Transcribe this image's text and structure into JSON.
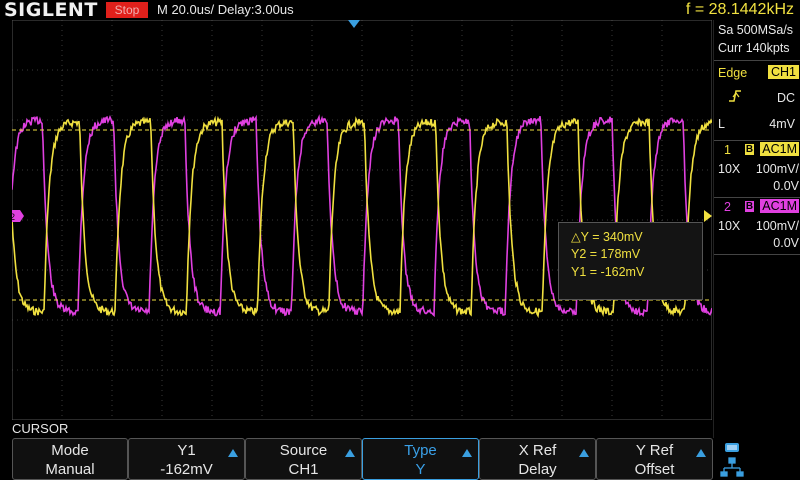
{
  "header": {
    "brand": "SIGLENT",
    "run_state": "Stop",
    "timebase": "M 20.0us/  Delay:3.00us",
    "frequency": "f = 28.1442kHz"
  },
  "acquisition": {
    "sample_rate": "Sa 500MSa/s",
    "memory": "Curr 140kpts"
  },
  "trigger": {
    "type": "Edge",
    "source": "CH1",
    "coupling": "DC",
    "level_prefix": "L",
    "level": "4mV"
  },
  "channels": [
    {
      "number": "1",
      "coupling": "AC1M",
      "probe": "10X",
      "scale": "100mV/",
      "offset": "0.0V",
      "color": "#f0e040"
    },
    {
      "number": "2",
      "coupling": "AC1M",
      "probe": "10X",
      "scale": "100mV/",
      "offset": "0.0V",
      "color": "#e040e0"
    }
  ],
  "measurement": {
    "delta_y": "△Y = 340mV",
    "y2": "Y2 = 178mV",
    "y1": "Y1 = -162mV"
  },
  "menu": {
    "title": "CURSOR",
    "softkeys": [
      {
        "line1": "Mode",
        "line2": "Manual",
        "arrow": false
      },
      {
        "line1": "Y1",
        "line2": "-162mV",
        "arrow": true
      },
      {
        "line1": "Source",
        "line2": "CH1",
        "arrow": true
      },
      {
        "line1": "Type",
        "line2": "Y",
        "arrow": true
      },
      {
        "line1": "X Ref",
        "line2": "Delay",
        "arrow": true
      },
      {
        "line1": "Y Ref",
        "line2": "Offset",
        "arrow": true
      }
    ]
  },
  "colors": {
    "ch1": "#f0e040",
    "ch2": "#e040e0",
    "accent": "#3a9fe0",
    "stop": "#e0201b"
  },
  "icons": {
    "usb": "usb-icon",
    "network": "network-icon",
    "trigger_slope": "rising-edge-icon"
  }
}
